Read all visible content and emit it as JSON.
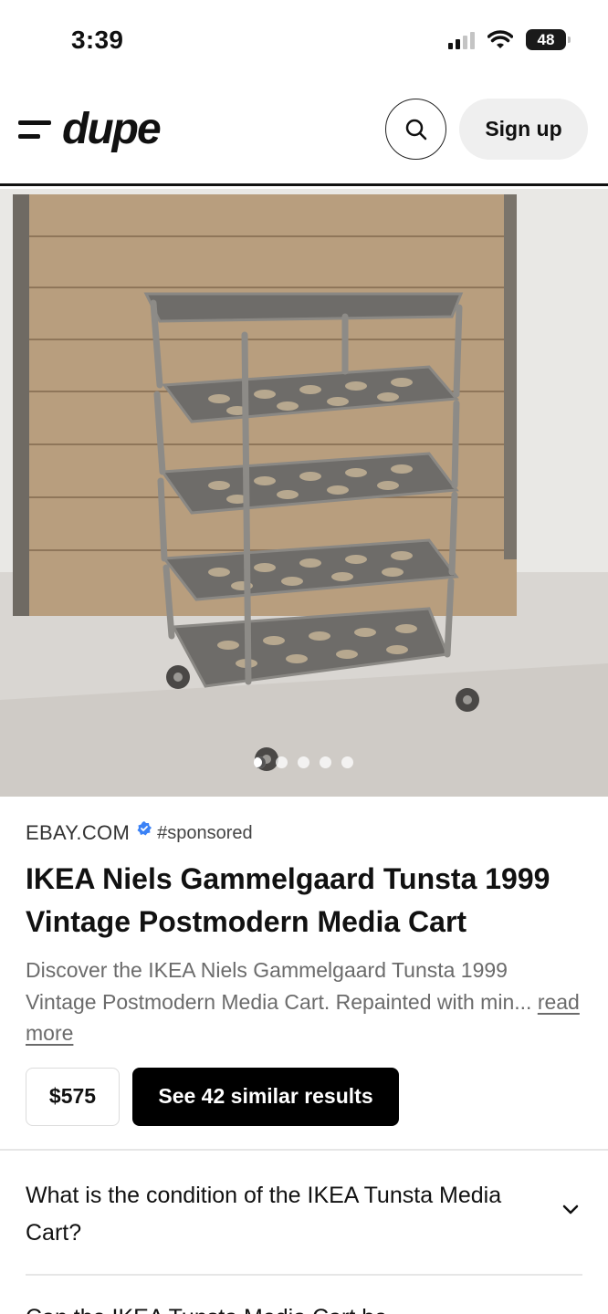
{
  "status_bar": {
    "time": "3:39",
    "battery": "48"
  },
  "header": {
    "logo_text": "dupe",
    "signup_label": "Sign up"
  },
  "gallery": {
    "image_count": 5,
    "active_index": 0
  },
  "product": {
    "source": "EBAY.COM",
    "sponsored": "#sponsored",
    "title": "IKEA Niels Gammelgaard Tunsta 1999 Vintage Postmodern Media Cart",
    "description": "Discover the IKEA Niels Gammelgaard Tunsta 1999 Vintage Postmodern Media Cart. Repainted with min...",
    "read_more": "read more",
    "price": "$575",
    "similar_button": "See 42 similar results"
  },
  "faq": [
    {
      "question": "What is the condition of the IKEA Tunsta Media Cart?"
    },
    {
      "question": "Can the IKEA Tunsta Media Cart be"
    }
  ],
  "colors": {
    "accent": "#000000",
    "verified": "#3b82f6",
    "muted_text": "#6b6b6b"
  }
}
